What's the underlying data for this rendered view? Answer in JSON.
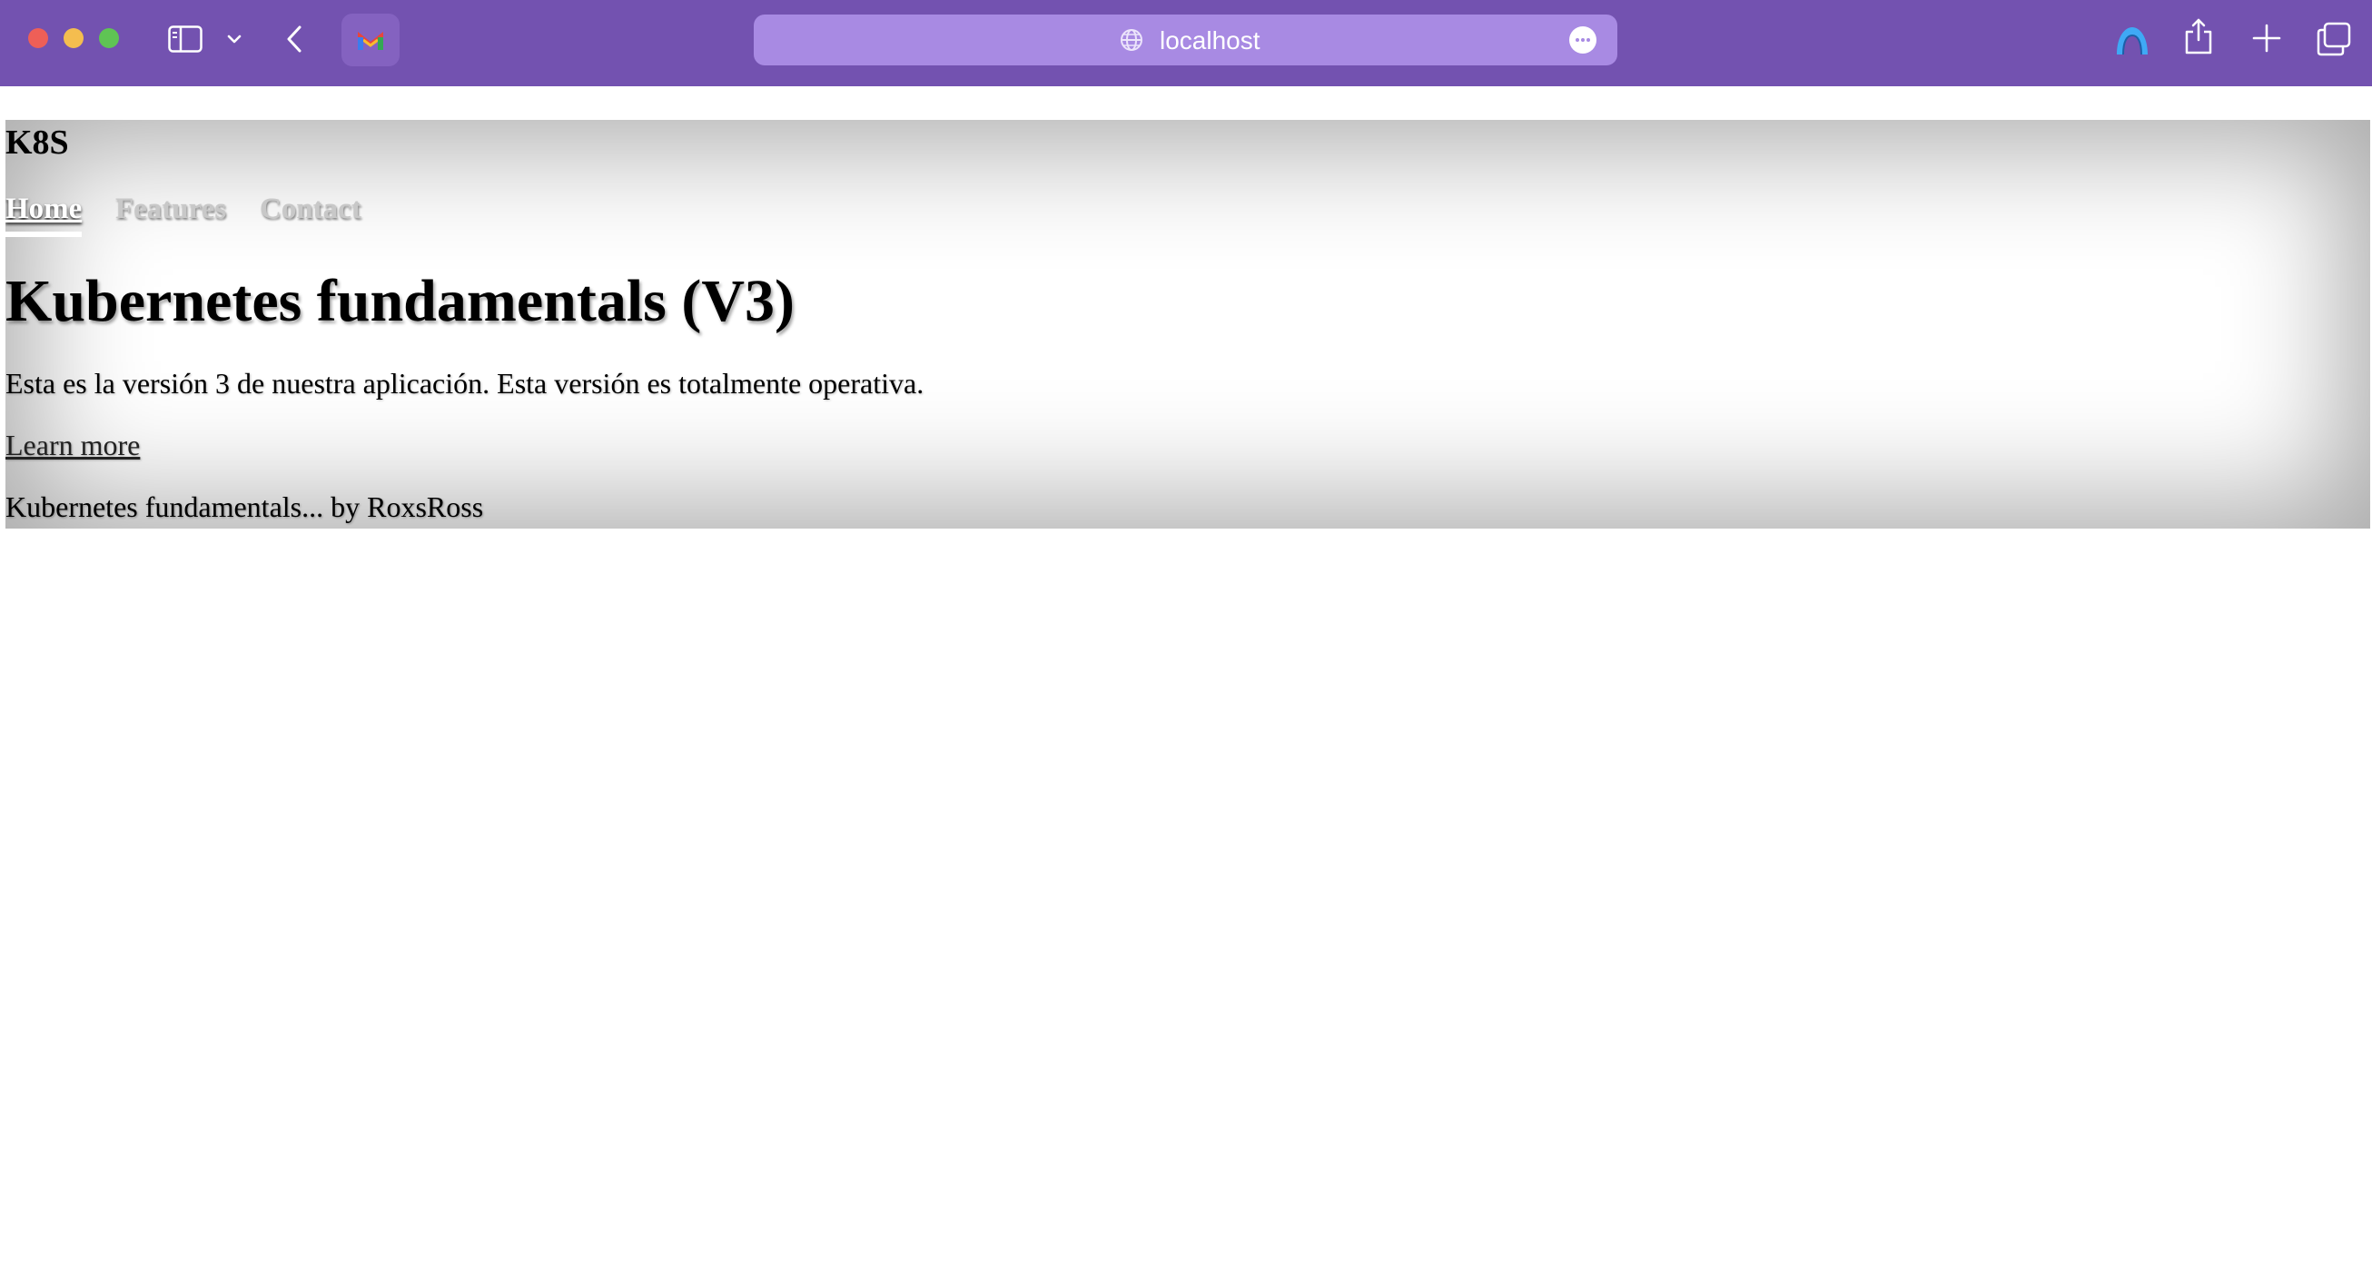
{
  "browser": {
    "url": "localhost",
    "icons": {
      "sidebar": "sidebar-icon",
      "dropdown": "chevron-down-icon",
      "back": "back-arrow-icon",
      "extension": "extension-icon",
      "site": "globe-icon",
      "more": "more-options-icon",
      "profile": "profile-icon",
      "share": "share-icon",
      "new_tab": "plus-icon",
      "tabs": "tab-overview-icon"
    },
    "colors": {
      "toolbar": "#7352b0",
      "address_bar": "#a88ae3"
    }
  },
  "page": {
    "logo": "K8S",
    "nav": [
      {
        "label": "Home",
        "active": true
      },
      {
        "label": "Features",
        "active": false
      },
      {
        "label": "Contact",
        "active": false
      }
    ],
    "title": "Kubernetes fundamentals (V3)",
    "lead": "Esta es la versión 3 de nuestra aplicación. Esta versión es totalmente operativa.",
    "cta": "Learn more",
    "footer": "Kubernetes fundamentals... by RoxsRoss"
  }
}
